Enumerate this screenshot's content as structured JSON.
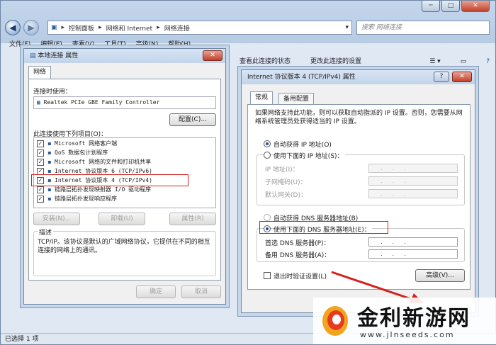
{
  "explorer": {
    "breadcrumb": [
      "控制面板",
      "网络和 Internet",
      "网络连接"
    ],
    "search_placeholder": "搜索 网络连接",
    "menu": [
      "文件(F)",
      "编辑(E)",
      "查看(V)",
      "工具(T)",
      "高级(N)",
      "帮助(H)"
    ],
    "commands": [
      "查看此连接的状态",
      "更改此连接的设置"
    ],
    "status": "已选择 1 项",
    "window_buttons": [
      "─",
      "□",
      "✕"
    ]
  },
  "props": {
    "title": "本地连接 属性",
    "tab": "网络",
    "connect_using_label": "连接时使用：",
    "adapter": "Realtek PCIe GBE Family Controller",
    "configure_btn": "配置(C)...",
    "items_label": "此连接使用下列项目(O)：",
    "items": [
      {
        "label": "Microsoft 网络客户端",
        "checked": true
      },
      {
        "label": "QoS 数据包计划程序",
        "checked": true
      },
      {
        "label": "Microsoft 网络的文件和打印机共享",
        "checked": true
      },
      {
        "label": "Internet 协议版本 6 (TCP/IPv6)",
        "checked": true
      },
      {
        "label": "Internet 协议版本 4 (TCP/IPv4)",
        "checked": true
      },
      {
        "label": "链路层拓扑发现映射器 I/O 驱动程序",
        "checked": true
      },
      {
        "label": "链路层拓扑发现响应程序",
        "checked": true
      }
    ],
    "install_btn": "安装(N)...",
    "uninstall_btn": "卸载(U)",
    "properties_btn": "属性(R)",
    "desc_label": "描述",
    "description": "TCP/IP。该协议是默认的广域网络协议，它提供在不同的相互连接的网络上的通讯。",
    "ok_btn": "确定",
    "cancel_btn": "取消"
  },
  "ipv4": {
    "title": "Internet 协议版本 4 (TCP/IPv4) 属性",
    "help": "?",
    "close": "✕",
    "tabs": [
      "常规",
      "备用配置"
    ],
    "intro": "如果网络支持此功能，则可以获取自动指派的 IP 设置。否则，您需要从网络系统管理员处获得适当的 IP 设置。",
    "auto_ip": "自动获得 IP 地址(O)",
    "manual_ip": "使用下面的 IP 地址(S)：",
    "ip_label": "IP 地址(I)：",
    "mask_label": "子网掩码(U)：",
    "gateway_label": "默认网关(D)：",
    "auto_dns": "自动获得 DNS 服务器地址(B)",
    "manual_dns": "使用下面的 DNS 服务器地址(E)：",
    "pref_dns": "首选 DNS 服务器(P)：",
    "alt_dns": "备用 DNS 服务器(A)：",
    "validate": "退出时验证设置(L)",
    "advanced_btn": "高级(V)...",
    "ip_dots": "...",
    "selected_ip_mode": "auto",
    "selected_dns_mode": "manual"
  },
  "watermark": {
    "brand": "金利新游网",
    "url": "www.jlnseeds.com"
  },
  "accent": "#d3201c"
}
